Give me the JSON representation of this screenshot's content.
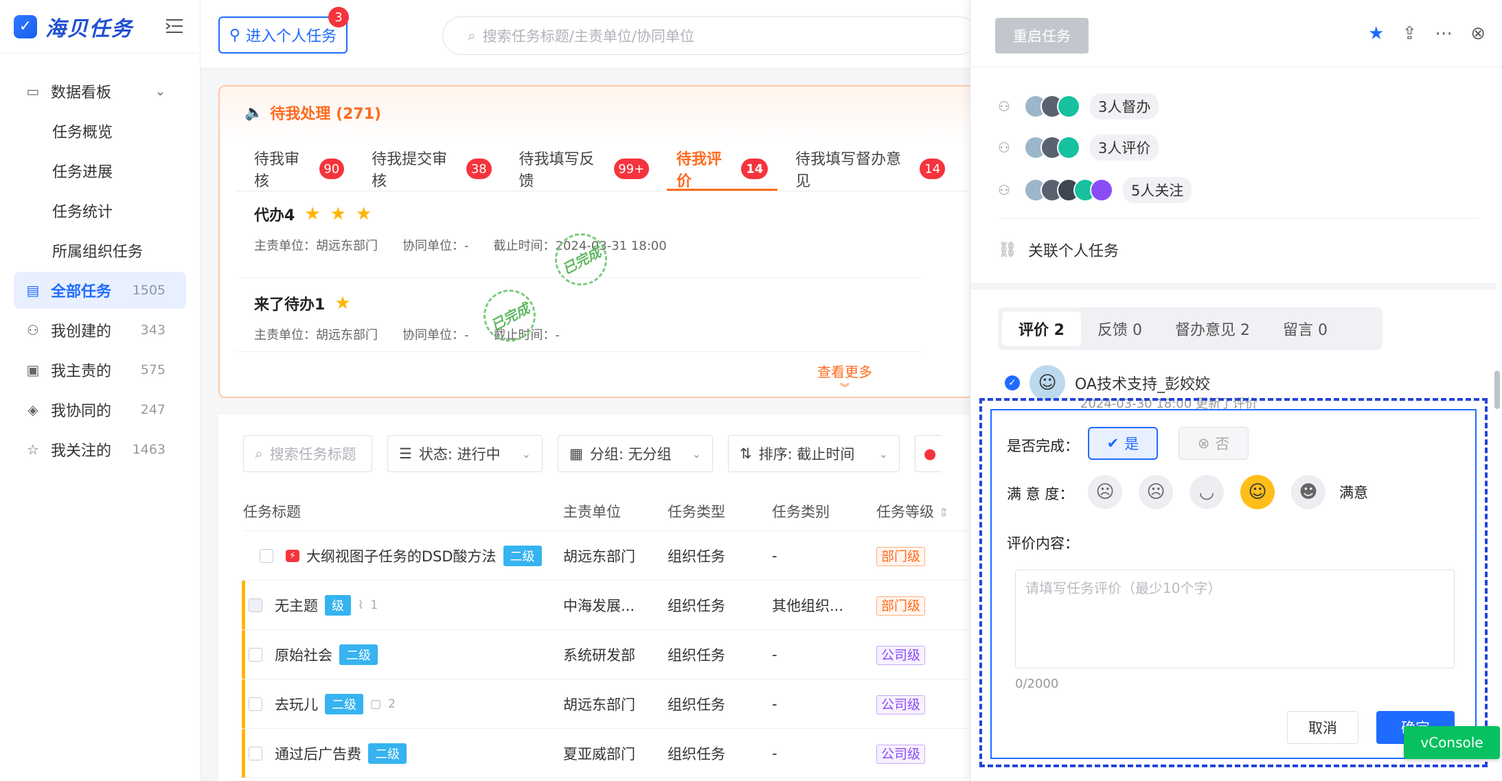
{
  "app": {
    "title": "海贝任务"
  },
  "sidebar": {
    "group": "数据看板",
    "sub_items": [
      "任务概览",
      "任务进展",
      "任务统计",
      "所属组织任务"
    ],
    "items": [
      {
        "label": "全部任务",
        "count": "1505"
      },
      {
        "label": "我创建的",
        "count": "343"
      },
      {
        "label": "我主责的",
        "count": "575"
      },
      {
        "label": "我协同的",
        "count": "247"
      },
      {
        "label": "我关注的",
        "count": "1463"
      }
    ]
  },
  "topbar": {
    "enter_personal": "进入个人任务",
    "enter_badge": "3",
    "search_placeholder": "搜索任务标题/主责单位/协同单位"
  },
  "pending": {
    "title": "待我处理 (271)",
    "tabs": [
      {
        "label": "待我审核",
        "badge": "90"
      },
      {
        "label": "待我提交审核",
        "badge": "38"
      },
      {
        "label": "待我填写反馈",
        "badge": "99+"
      },
      {
        "label": "待我评价",
        "badge": "14"
      },
      {
        "label": "待我填写督办意见",
        "badge": "14"
      }
    ],
    "rows": [
      {
        "title": "代办4",
        "owner": "主责单位：胡远东部门",
        "collab": "协同单位：-",
        "deadline": "截止时间：2024-03-31 18:00",
        "stamp": "已完成"
      },
      {
        "title": "来了待办1",
        "owner": "主责单位：胡远东部门",
        "collab": "协同单位：-",
        "deadline": "截止时间：-",
        "stamp": "已完成"
      }
    ],
    "see_more": "查看更多"
  },
  "list": {
    "search_placeholder": "搜索任务标题",
    "status": "状态: 进行中",
    "group": "分组: 无分组",
    "sort": "排序: 截止时间",
    "headers": [
      "任务标题",
      "主责单位",
      "任务类型",
      "任务类别",
      "任务等级"
    ],
    "rows": [
      {
        "title": "大纲视图子任务的DSD酸方法",
        "level": "二级",
        "meta": "",
        "owner": "胡远东部门",
        "type": "组织任务",
        "cat": "-",
        "grade": "部门级"
      },
      {
        "title": "无主题",
        "level": "级",
        "meta": "1",
        "owner": "中海发展...",
        "type": "组织任务",
        "cat": "其他组织...",
        "grade": "部门级"
      },
      {
        "title": "原始社会",
        "level": "二级",
        "meta": "",
        "owner": "系统研发部",
        "type": "组织任务",
        "cat": "-",
        "grade": "公司级"
      },
      {
        "title": "去玩儿",
        "level": "二级",
        "meta": "2",
        "owner": "胡远东部门",
        "type": "组织任务",
        "cat": "-",
        "grade": "公司级"
      },
      {
        "title": "通过后广告费",
        "level": "二级",
        "meta": "",
        "owner": "夏亚威部门",
        "type": "组织任务",
        "cat": "-",
        "grade": "公司级"
      }
    ]
  },
  "drawer": {
    "restart": "重启任务",
    "supervise": "3人督办",
    "evaluate": "3人评价",
    "follow": "5人关注",
    "related": "关联个人任务",
    "tabs": [
      "评价 2",
      "反馈 0",
      "督办意见 2",
      "留言 0"
    ],
    "commenter": "OA技术支持_彭姣姣",
    "comment_meta": "2024-03-30 18:00 更新了评价"
  },
  "eval_form": {
    "completed_label": "是否完成：",
    "yes": "是",
    "no": "否",
    "satisfaction_label": "满 意 度：",
    "satisfaction_value": "满意",
    "content_label": "评价内容：",
    "placeholder": "请填写任务评价（最少10个字）",
    "counter": "0/2000",
    "cancel": "取消",
    "ok": "确定"
  },
  "vconsole": "vConsole",
  "colors": {
    "primary": "#1f6bff",
    "orange": "#ff6a1c",
    "badge": "#f5343d"
  }
}
